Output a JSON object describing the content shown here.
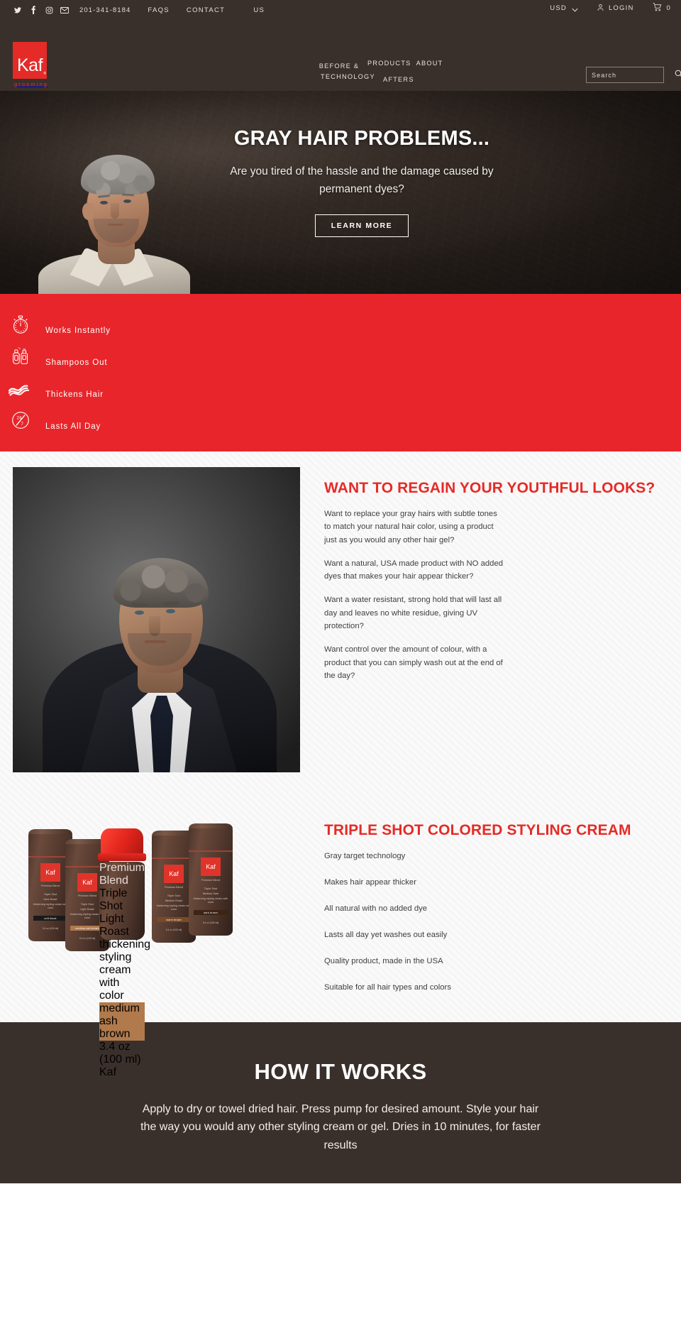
{
  "topbar": {
    "social": [
      {
        "name": "twitter-icon",
        "label": "Twitter"
      },
      {
        "name": "facebook-icon",
        "label": "Facebook"
      },
      {
        "name": "instagram-icon",
        "label": "Instagram"
      },
      {
        "name": "email-icon",
        "label": "Email"
      }
    ],
    "phone": "201-341-8184",
    "faqs": "FAQS",
    "contact": "CONTACT",
    "contact_us": "US",
    "currency": "USD",
    "login": "LOGIN",
    "cart_count": "0"
  },
  "header": {
    "logo_text": "Kaf",
    "logo_reg": "®",
    "logo_sub": "grooming",
    "nav": [
      {
        "label": "BEFORE &"
      },
      {
        "label": "AFTERS"
      },
      {
        "label": "PRODUCTS"
      },
      {
        "label": "ABOUT"
      },
      {
        "label": "TECHNOLOGY"
      }
    ],
    "search_placeholder": "Search",
    "search_value": ""
  },
  "hero": {
    "title": "GRAY HAIR PROBLEMS...",
    "subtitle": "Are you tired of the hassle and the damage caused by permanent dyes?",
    "cta": "LEARN MORE"
  },
  "features": [
    {
      "icon": "stopwatch-icon",
      "label": "Works Instantly"
    },
    {
      "icon": "shampoo-bottles-icon",
      "label": "Shampoos Out"
    },
    {
      "icon": "hair-waves-icon",
      "label": "Thickens Hair"
    },
    {
      "icon": "24-7-clock-icon",
      "label": "Lasts All Day"
    }
  ],
  "regain": {
    "heading": "WANT TO REGAIN YOUR YOUTHFUL LOOKS?",
    "paragraphs": [
      "Want to replace your gray hairs with subtle tones to match your natural hair color, using a product just as you would any other hair gel?",
      "Want a natural, USA made product with NO added dyes that makes your hair appear thicker?",
      "Want a water resistant, strong hold that will last all day and leaves no white residue, giving  UV protection?",
      "Want control over the amount of colour, with a product that you can simply wash out at the end of the day?"
    ]
  },
  "tripleshot": {
    "heading": "TRIPLE SHOT COLORED STYLING CREAM",
    "bullets": [
      "Gray target technology",
      "Makes hair appear thicker",
      "All natural with no added dye",
      "Lasts all day yet washes out easily",
      "Quality product, made in the USA",
      "Suitable for all hair types and colors"
    ],
    "bottles": [
      {
        "brand": "Kaf",
        "blend": "Premium Blend",
        "line1": "Triple Shot",
        "line2": "Dark Roast",
        "desc": "thickening styling cream with color",
        "shade": "soft black",
        "size": "3.4 oz (100 ml)"
      },
      {
        "brand": "Kaf",
        "blend": "Premium Blend",
        "line1": "Triple Shot",
        "line2": "Light Roast",
        "desc": "thickening styling cream with color",
        "shade": "medium ash brown",
        "size": "3.4 oz (100 ml)"
      },
      {
        "brand": "Kaf",
        "blend": "Premium Blend",
        "line1": "Triple Shot",
        "line2": "Light Roast",
        "desc": "thickening styling cream with color",
        "shade": "medium ash brown",
        "size": "3.4 oz (100 ml)"
      },
      {
        "brand": "Kaf",
        "blend": "Premium Blend",
        "line1": "Triple Shot",
        "line2": "Medium Roast",
        "desc": "thickening styling cream with color",
        "shade": "warm brown",
        "size": "3.4 oz (100 ml)"
      },
      {
        "brand": "Kaf",
        "blend": "Premium Blend",
        "line1": "Triple Shot",
        "line2": "Medium Dark",
        "desc": "thickening styling cream with color",
        "shade": "dark brown",
        "size": "3.4 oz (100 ml)"
      }
    ]
  },
  "how": {
    "heading": "HOW IT WORKS",
    "body": "Apply to dry or towel dried hair. Press pump for desired amount. Style your hair the way you would any other styling cream or gel. Dries in 10 minutes, for faster results"
  },
  "colors": {
    "brand_red": "#e52b27",
    "feature_red": "#e8252a",
    "dark_brown": "#3a302b",
    "body_text": "#3f3f3f"
  }
}
